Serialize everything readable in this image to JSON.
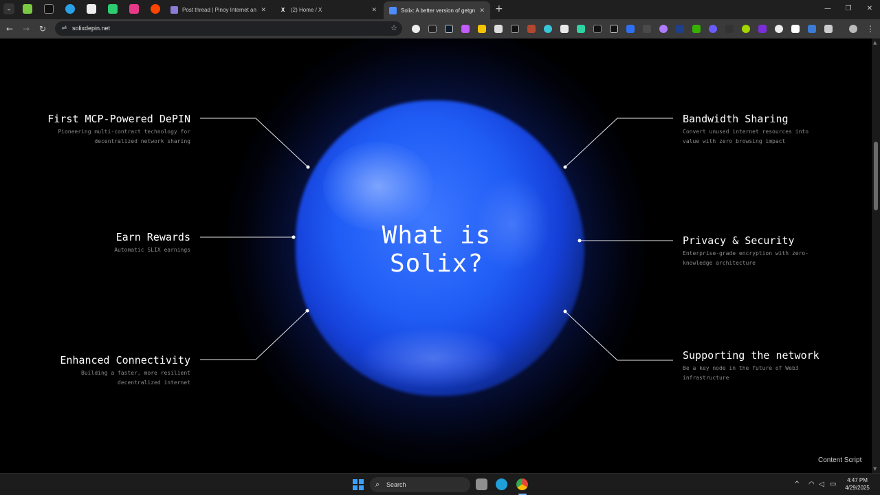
{
  "browser": {
    "tabs": [
      {
        "label": "Post thread | Pinoy Internet and",
        "icon": "forum-icon",
        "active": false
      },
      {
        "label": "(2) Home / X",
        "icon": "x-logo-icon",
        "active": false
      },
      {
        "label": "Solix: A better version of getgra",
        "icon": "solix-logo-icon",
        "active": true
      }
    ],
    "close_glyph": "✕",
    "new_tab_glyph": "+",
    "window_controls": {
      "minimize": "—",
      "maximize": "❐",
      "close": "✕"
    },
    "url": "solixdepin.net",
    "site_info_glyph": "⇌",
    "bookmark_glyph": "☆"
  },
  "page": {
    "title_line1": "What is",
    "title_line2": "Solix?",
    "features_left": [
      {
        "title": "First MCP-Powered DePIN",
        "desc_line1": "Pioneering multi-contract technology for",
        "desc_line2": "decentralized network sharing"
      },
      {
        "title": "Earn Rewards",
        "desc_line1": "Automatic SLIX earnings",
        "desc_line2": ""
      },
      {
        "title": "Enhanced Connectivity",
        "desc_line1": "Building a faster, more resilient",
        "desc_line2": "decentralized internet"
      }
    ],
    "features_right": [
      {
        "title": "Bandwidth Sharing",
        "desc_line1": "Convert unused internet resources into",
        "desc_line2": "value with zero browsing impact"
      },
      {
        "title": "Privacy & Security",
        "desc_line1": "Enterprise-grade encryption with zero-",
        "desc_line2": "knowledge architecture"
      },
      {
        "title": "Supporting the network",
        "desc_line1": "Be a key node in the future of Web3",
        "desc_line2": "infrastructure"
      }
    ],
    "content_script_label": "Content Script"
  },
  "taskbar": {
    "search_label": "Search",
    "time": "4:47 PM",
    "date": "4/29/2025"
  },
  "colors": {
    "accent_blue": "#1f5cf5",
    "page_bg": "#000000",
    "chrome_tabstrip": "#1f1f1f",
    "chrome_toolbar": "#3a3a3a"
  }
}
